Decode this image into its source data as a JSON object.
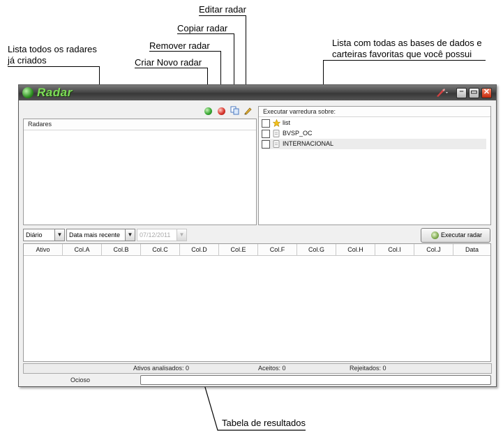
{
  "annotations": {
    "editar": "Editar radar",
    "copiar": "Copiar radar",
    "remover": "Remover radar",
    "criar": "Criar Novo radar",
    "lista_l1": "Lista todos os radares",
    "lista_l2": "já criados",
    "bases_l1": "Lista com todas as bases de dados e",
    "bases_l2": "carteiras favoritas que você possui",
    "tabela": "Tabela de resultados"
  },
  "window": {
    "title": "Radar",
    "radares_header": "Radares",
    "varredura_header": "Executar varredura sobre:",
    "databases": [
      {
        "label": "list",
        "icon": "star-icon",
        "checked": false
      },
      {
        "label": "BVSP_OC",
        "icon": "database-icon",
        "checked": false
      },
      {
        "label": "INTERNACIONAL",
        "icon": "database-icon",
        "checked": false
      }
    ],
    "period_select": "Diário",
    "order_select": "Data mais recente",
    "date_select": "07/12/2011",
    "run_button": "Executar radar",
    "columns": [
      "Ativo",
      "Col.A",
      "Col.B",
      "Col.C",
      "Col.D",
      "Col.E",
      "Col.F",
      "Col.G",
      "Col.H",
      "Col.I",
      "Col.J",
      "Data"
    ],
    "status": {
      "analisados": "Ativos analisados: 0",
      "aceitos": "Aceitos: 0",
      "rejeitados": "Rejeitados: 0"
    },
    "state": "Ocioso"
  },
  "colors": {
    "title_green": "#7ddc57",
    "create_icon": "#3aa935",
    "remove_icon": "#d9362e"
  }
}
